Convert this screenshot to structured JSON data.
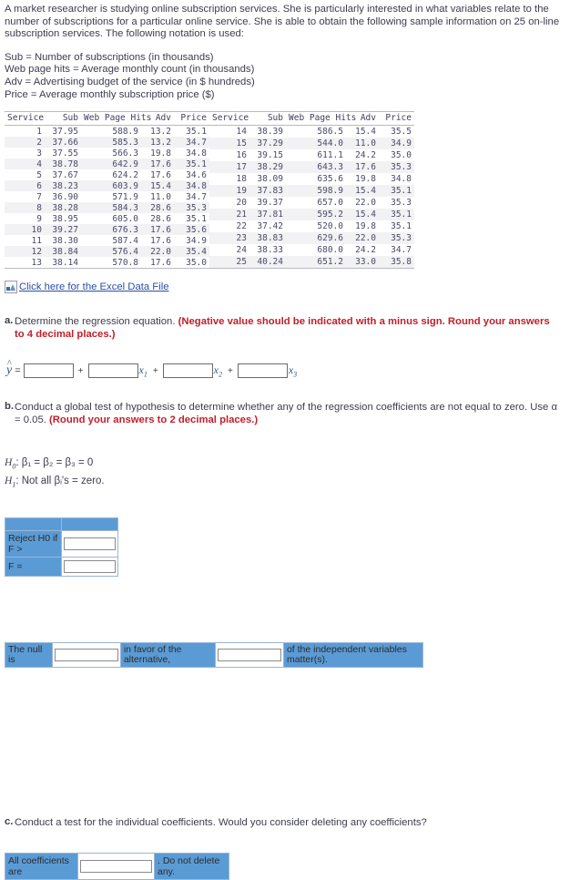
{
  "intro": {
    "paragraph": "A market researcher is studying online subscription services. She is particularly interested in what variables relate to the number of subscriptions for a particular online service. She is able to obtain the following sample information on 25 on-line subscription services. The following notation is used:",
    "notation": [
      "Sub = Number of subscriptions (in thousands)",
      "Web page hits = Average monthly count (in thousands)",
      "Adv = Advertising budget of the service (in $ hundreds)",
      "Price = Average monthly subscription price ($)"
    ]
  },
  "data_table": {
    "columns": [
      "Service",
      "Sub",
      "Web Page Hits",
      "Adv",
      "Price"
    ],
    "left_rows": [
      [
        "1",
        "37.95",
        "588.9",
        "13.2",
        "35.1"
      ],
      [
        "2",
        "37.66",
        "585.3",
        "13.2",
        "34.7"
      ],
      [
        "3",
        "37.55",
        "566.3",
        "19.8",
        "34.8"
      ],
      [
        "4",
        "38.78",
        "642.9",
        "17.6",
        "35.1"
      ],
      [
        "5",
        "37.67",
        "624.2",
        "17.6",
        "34.6"
      ],
      [
        "6",
        "38.23",
        "603.9",
        "15.4",
        "34.8"
      ],
      [
        "7",
        "36.90",
        "571.9",
        "11.0",
        "34.7"
      ],
      [
        "8",
        "38.28",
        "584.3",
        "28.6",
        "35.3"
      ],
      [
        "9",
        "38.95",
        "605.0",
        "28.6",
        "35.1"
      ],
      [
        "10",
        "39.27",
        "676.3",
        "17.6",
        "35.6"
      ],
      [
        "11",
        "38.30",
        "587.4",
        "17.6",
        "34.9"
      ],
      [
        "12",
        "38.84",
        "576.4",
        "22.0",
        "35.4"
      ],
      [
        "13",
        "38.14",
        "570.8",
        "17.6",
        "35.0"
      ]
    ],
    "right_rows": [
      [
        "14",
        "38.39",
        "586.5",
        "15.4",
        "35.5"
      ],
      [
        "15",
        "37.29",
        "544.0",
        "11.0",
        "34.9"
      ],
      [
        "16",
        "39.15",
        "611.1",
        "24.2",
        "35.0"
      ],
      [
        "17",
        "38.29",
        "643.3",
        "17.6",
        "35.3"
      ],
      [
        "18",
        "38.09",
        "635.6",
        "19.8",
        "34.8"
      ],
      [
        "19",
        "37.83",
        "598.9",
        "15.4",
        "35.1"
      ],
      [
        "20",
        "39.37",
        "657.0",
        "22.0",
        "35.3"
      ],
      [
        "21",
        "37.81",
        "595.2",
        "15.4",
        "35.1"
      ],
      [
        "22",
        "37.42",
        "520.0",
        "19.8",
        "35.1"
      ],
      [
        "23",
        "38.83",
        "629.6",
        "22.0",
        "35.3"
      ],
      [
        "24",
        "38.33",
        "680.0",
        "24.2",
        "34.7"
      ],
      [
        "25",
        "40.24",
        "651.2",
        "33.0",
        "35.8"
      ]
    ]
  },
  "excel": {
    "alt_text": "picture",
    "link_text": "Click here for the Excel Data File",
    "icon": "broken-image-icon"
  },
  "part_a": {
    "letter": "a.",
    "text_plain": "Determine the regression equation. ",
    "text_red": "(Negative value should be indicated with a minus sign. Round your answers to 4 decimal places.)",
    "equation": {
      "yhat": "y",
      "hat": "^",
      "equals": "=",
      "op1": "+",
      "op2": "+",
      "op3": "+",
      "x1": "x",
      "x1sub": "1",
      "x2": "x",
      "x2sub": "2",
      "x3": "x",
      "x3sub": "3",
      "value_intercept": "",
      "value_b1": "",
      "value_b2": "",
      "value_b3": "",
      "placeholder": ""
    }
  },
  "part_b": {
    "letter": "b.",
    "text_plain": "Conduct a global test of hypothesis to determine whether any of the regression coefficients are not equal to zero. Use α = 0.05. ",
    "text_red": "(Round your answers to 2 decimal places.)",
    "h0": {
      "symbol": "H",
      "sub": "0",
      "statement": ": β₁ = β₂ = β₃ = 0"
    },
    "h1": {
      "symbol": "H",
      "sub": "1",
      "statement": ": Not all βᵢ's = zero."
    },
    "reject_table": {
      "row1_label": "Reject H0 if F >",
      "row1_value": "",
      "row2_label": "F =",
      "row2_value": ""
    },
    "null_table": {
      "label": "The null is",
      "value1": "",
      "text1": "in favor of the alternative,",
      "value2": "",
      "text2": "of the independent variables matter(s)."
    }
  },
  "part_c": {
    "letter": "c.",
    "text_plain": "Conduct a test for the individual coefficients. Would you consider deleting any coefficients?",
    "coef_table": {
      "label": "All coefficients are",
      "value": "",
      "suffix": ". Do not delete any."
    }
  },
  "colors": {
    "accent_blue": "#5b9bd5",
    "link_blue": "#2b4fa2",
    "red": "#c0202a",
    "text": "#3d3d4d"
  }
}
